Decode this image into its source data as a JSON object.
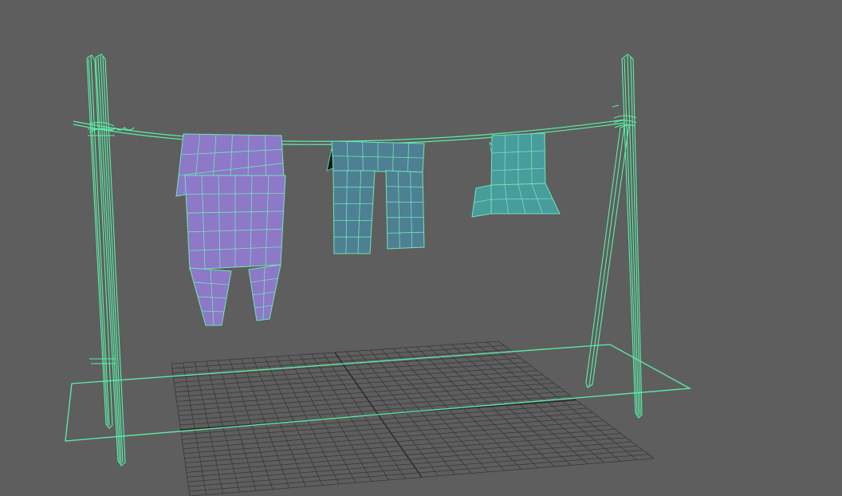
{
  "viewport": {
    "name": "perspective-viewport",
    "hud_text": "",
    "colors": {
      "background": "#5e5e5e",
      "grid_line": "#383838",
      "grid_axis": "#262626",
      "selection_wire": "#5cf0a8",
      "shirt_fill": "#8e78c8",
      "pants_fill": "#4f7f92",
      "small_garment_fill": "#489c9c",
      "garment_wire": "#6ee6b8"
    }
  },
  "scene": {
    "objects": [
      {
        "id": "left-post",
        "kind": "pole",
        "selected": true
      },
      {
        "id": "right-post",
        "kind": "pole",
        "selected": true
      },
      {
        "id": "clothesline-rope",
        "kind": "rope",
        "selected": true
      },
      {
        "id": "ground-plane",
        "kind": "plane",
        "selected": true
      },
      {
        "id": "purple-shirt",
        "kind": "garment",
        "selected": false
      },
      {
        "id": "blue-pants",
        "kind": "garment",
        "selected": false
      },
      {
        "id": "teal-garment",
        "kind": "garment",
        "selected": false
      }
    ]
  }
}
